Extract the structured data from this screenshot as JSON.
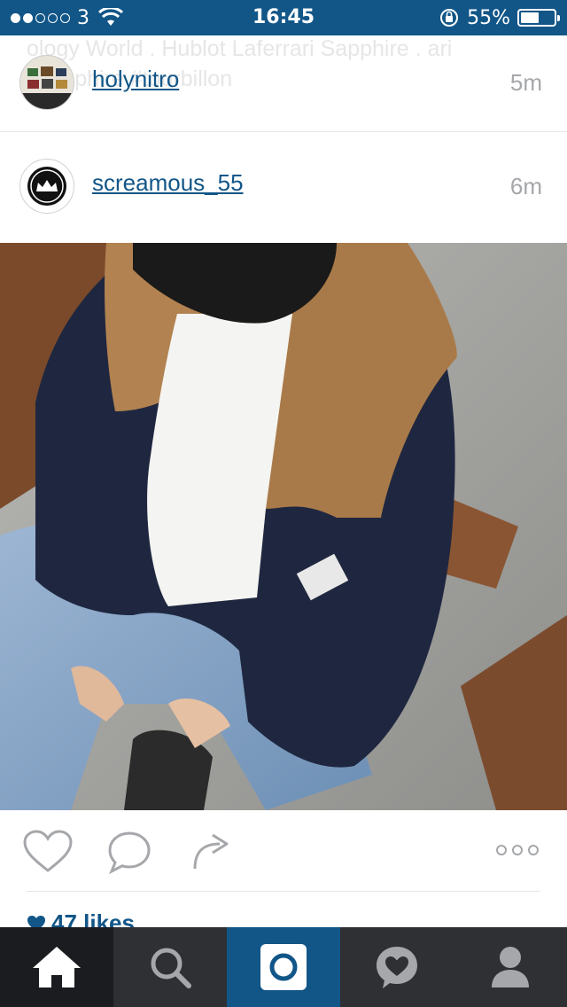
{
  "status_bar": {
    "carrier": "3",
    "time": "16:45",
    "battery_percent": "55%",
    "battery_level": 0.55,
    "signal_bars_on": 2,
    "signal_bars_total": 5
  },
  "feed": {
    "previous_caption": "ology World . Hublot Laferrari Sapphire . ari #sapphire #tourbillon",
    "posts": [
      {
        "username": "holynitro",
        "time_ago": "5m"
      },
      {
        "username": "screamous_55",
        "time_ago": "6m"
      }
    ],
    "likes_text": "47 likes"
  },
  "icons": {
    "like": "heart-icon",
    "comment": "comment-bubble-icon",
    "share": "share-arrow-icon",
    "more": "more-options-icon"
  },
  "tab_bar": {
    "tabs": [
      "home-icon",
      "search-icon",
      "camera-icon",
      "activity-heart-icon",
      "profile-icon"
    ],
    "active_color": "#1b1c1f",
    "camera_color": "#125688"
  },
  "colors": {
    "brand": "#125688",
    "muted": "#a5a7aa"
  }
}
